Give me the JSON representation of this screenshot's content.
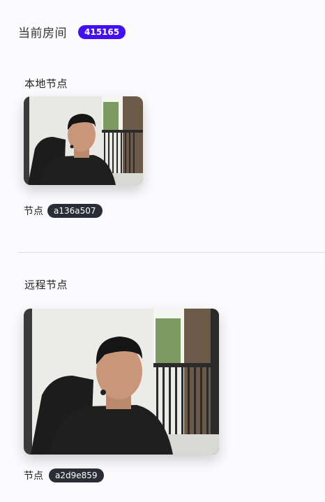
{
  "room": {
    "label": "当前房间",
    "id": "415165",
    "accent_color": "#4310f5"
  },
  "local": {
    "title": "本地节点",
    "node_label": "节点",
    "node_id": "a136a507",
    "video_icon": "camera-feed"
  },
  "remote": {
    "title": "远程节点",
    "node_label": "节点",
    "node_id": "a2d9e859",
    "video_icon": "camera-feed"
  }
}
